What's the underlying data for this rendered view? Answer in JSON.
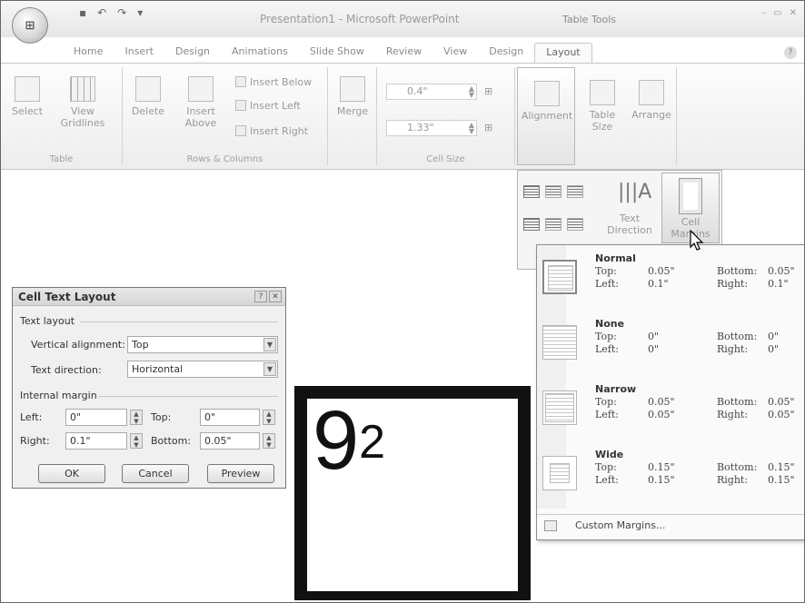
{
  "titlebar": {
    "title": "Presentation1 - Microsoft PowerPoint",
    "context_tools": "Table Tools"
  },
  "tabs": [
    {
      "label": "Home"
    },
    {
      "label": "Insert"
    },
    {
      "label": "Design"
    },
    {
      "label": "Animations"
    },
    {
      "label": "Slide Show"
    },
    {
      "label": "Review"
    },
    {
      "label": "View"
    },
    {
      "label": "Design"
    },
    {
      "label": "Layout",
      "active": true
    }
  ],
  "ribbon": {
    "table_group": {
      "label": "Table",
      "select": "Select",
      "view_gridlines": "View Gridlines"
    },
    "rows_columns_group": {
      "label": "Rows & Columns",
      "delete": "Delete",
      "insert_above": "Insert Above",
      "insert_below": "Insert Below",
      "insert_left": "Insert Left",
      "insert_right": "Insert Right"
    },
    "merge": "Merge",
    "cell_size_group": {
      "label": "Cell Size",
      "height": "0.4\"",
      "width": "1.33\""
    },
    "alignment": "Alignment",
    "table_size": "Table Size",
    "arrange": "Arrange"
  },
  "alignment_panel": {
    "text_direction": "Text Direction",
    "cell_margins": "Cell Margins"
  },
  "margins_menu": {
    "presets": [
      {
        "name": "Normal",
        "top": "0.05\"",
        "bottom": "0.05\"",
        "left": "0.1\"",
        "right": "0.1\""
      },
      {
        "name": "None",
        "top": "0\"",
        "bottom": "0\"",
        "left": "0\"",
        "right": "0\""
      },
      {
        "name": "Narrow",
        "top": "0.05\"",
        "bottom": "0.05\"",
        "left": "0.05\"",
        "right": "0.05\""
      },
      {
        "name": "Wide",
        "top": "0.15\"",
        "bottom": "0.15\"",
        "left": "0.15\"",
        "right": "0.15\""
      }
    ],
    "labels": {
      "top": "Top:",
      "bottom": "Bottom:",
      "left": "Left:",
      "right": "Right:"
    },
    "custom": "Custom Margins..."
  },
  "dialog": {
    "title": "Cell Text Layout",
    "text_layout_section": "Text layout",
    "vertical_alignment_label": "Vertical alignment:",
    "vertical_alignment_value": "Top",
    "text_direction_label": "Text direction:",
    "text_direction_value": "Horizontal",
    "internal_margin_section": "Internal margin",
    "left_label": "Left:",
    "left_value": "0\"",
    "right_label": "Right:",
    "right_value": "0.1\"",
    "top_label": "Top:",
    "top_value": "0\"",
    "bottom_label": "Bottom:",
    "bottom_value": "0.05\"",
    "ok": "OK",
    "cancel": "Cancel",
    "preview": "Preview"
  },
  "slide": {
    "base": "9",
    "exponent": "2"
  }
}
